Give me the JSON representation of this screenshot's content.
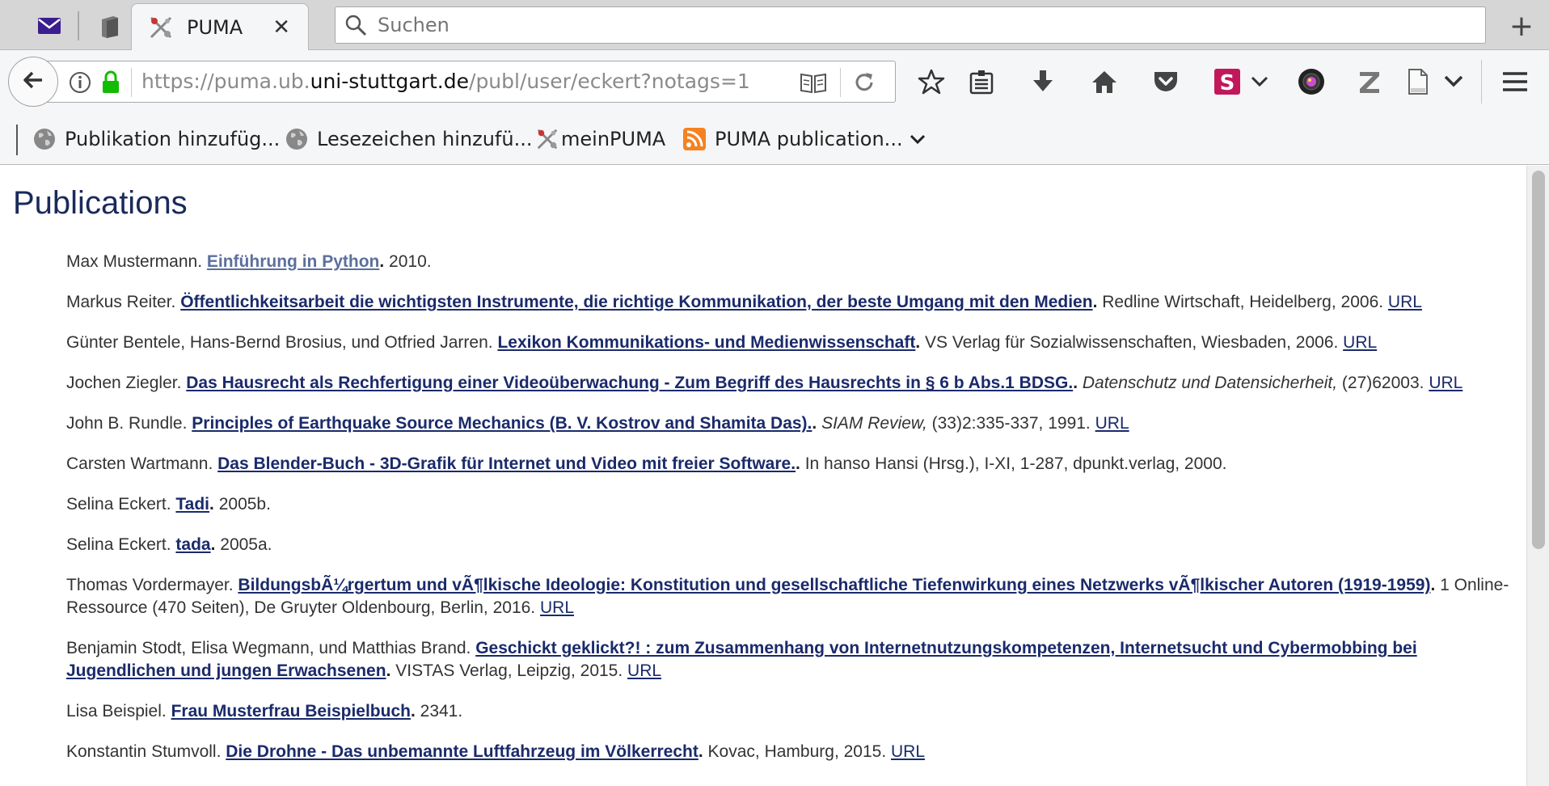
{
  "tabs": {
    "active_title": "PUMA",
    "close_glyph": "✕",
    "new_tab_glyph": "+"
  },
  "search": {
    "placeholder": "Suchen"
  },
  "urlbar": {
    "scheme_prefix": "https://puma.ub.",
    "host": "uni-stuttgart.de",
    "path": "/publ/user/eckert?notags=1"
  },
  "bookmarks": [
    {
      "label": "Publikation hinzufüg...",
      "icon": "globe-icon"
    },
    {
      "label": "Lesezeichen hinzufü...",
      "icon": "globe-icon"
    },
    {
      "label": "meinPUMA",
      "icon": "puma-logo-icon"
    },
    {
      "label": "PUMA publication...",
      "icon": "rss-icon"
    }
  ],
  "colors": {
    "heading": "#1a2a5a",
    "link": "#1a2a6b",
    "visited_link": "#5c6f9c",
    "accent_red": "#c2185b"
  },
  "page": {
    "heading": "Publications"
  },
  "publications": [
    {
      "authors": "Max Mustermann. ",
      "title": "Einführung in Python",
      "rest_plain": " 2010.",
      "visited": true
    },
    {
      "authors": "Markus Reiter. ",
      "title": "Öffentlichkeitsarbeit die wichtigsten Instrumente, die richtige Kommunikation, der beste Umgang mit den Medien",
      "rest_plain": " Redline Wirtschaft, Heidelberg, 2006. ",
      "url": "URL"
    },
    {
      "authors": "Günter Bentele, Hans-Bernd Brosius, und Otfried Jarren. ",
      "title": "Lexikon Kommunikations- und Medienwissenschaft",
      "rest_plain": " VS Verlag für Sozialwissenschaften, Wiesbaden, 2006. ",
      "url": "URL"
    },
    {
      "authors": "Jochen Ziegler. ",
      "title": "Das Hausrecht als Rechfertigung einer Videoüberwachung - Zum Begriff des Hausrechts in § 6 b Abs.1 BDSG.",
      "rest_italic": " Datenschutz und Datensicherheit,",
      "rest_plain": " (27)62003. ",
      "url": "URL"
    },
    {
      "authors": "John B. Rundle. ",
      "title": "Principles of Earthquake Source Mechanics (B. V. Kostrov and Shamita Das).",
      "rest_italic": " SIAM Review,",
      "rest_plain": " (33)2:335-337, 1991. ",
      "url": "URL"
    },
    {
      "authors": "Carsten Wartmann. ",
      "title": "Das Blender-Buch - 3D-Grafik für Internet und Video mit freier Software.",
      "rest_plain": " In hanso Hansi (Hrsg.), I-XI, 1-287, dpunkt.verlag, 2000."
    },
    {
      "authors": "Selina Eckert. ",
      "title": "Tadi",
      "rest_plain": " 2005b."
    },
    {
      "authors": "Selina Eckert. ",
      "title": "tada",
      "rest_plain": " 2005a."
    },
    {
      "authors": "Thomas Vordermayer. ",
      "title": "BildungsbÃ¼rgertum und vÃ¶lkische Ideologie: Konstitution und gesellschaftliche Tiefenwirkung eines Netzwerks vÃ¶lkischer Autoren (1919-1959)",
      "rest_plain": " 1 Online-Ressource (470 Seiten), De Gruyter Oldenbourg, Berlin, 2016. ",
      "url": "URL"
    },
    {
      "authors": "Benjamin Stodt, Elisa Wegmann, und Matthias Brand. ",
      "title": "Geschickt geklickt?! : zum Zusammenhang von Internetnutzungskompetenzen, Internetsucht und Cybermobbing bei Jugendlichen und jungen Erwachsenen",
      "rest_plain": " VISTAS Verlag, Leipzig, 2015. ",
      "url": "URL"
    },
    {
      "authors": "Lisa Beispiel. ",
      "title": "Frau Musterfrau Beispielbuch",
      "rest_plain": " 2341."
    },
    {
      "authors": "Konstantin Stumvoll. ",
      "title": "Die Drohne - Das unbemannte Luftfahrzeug im Völkerrecht",
      "rest_plain": " Kovac, Hamburg, 2015. ",
      "url": "URL"
    }
  ]
}
